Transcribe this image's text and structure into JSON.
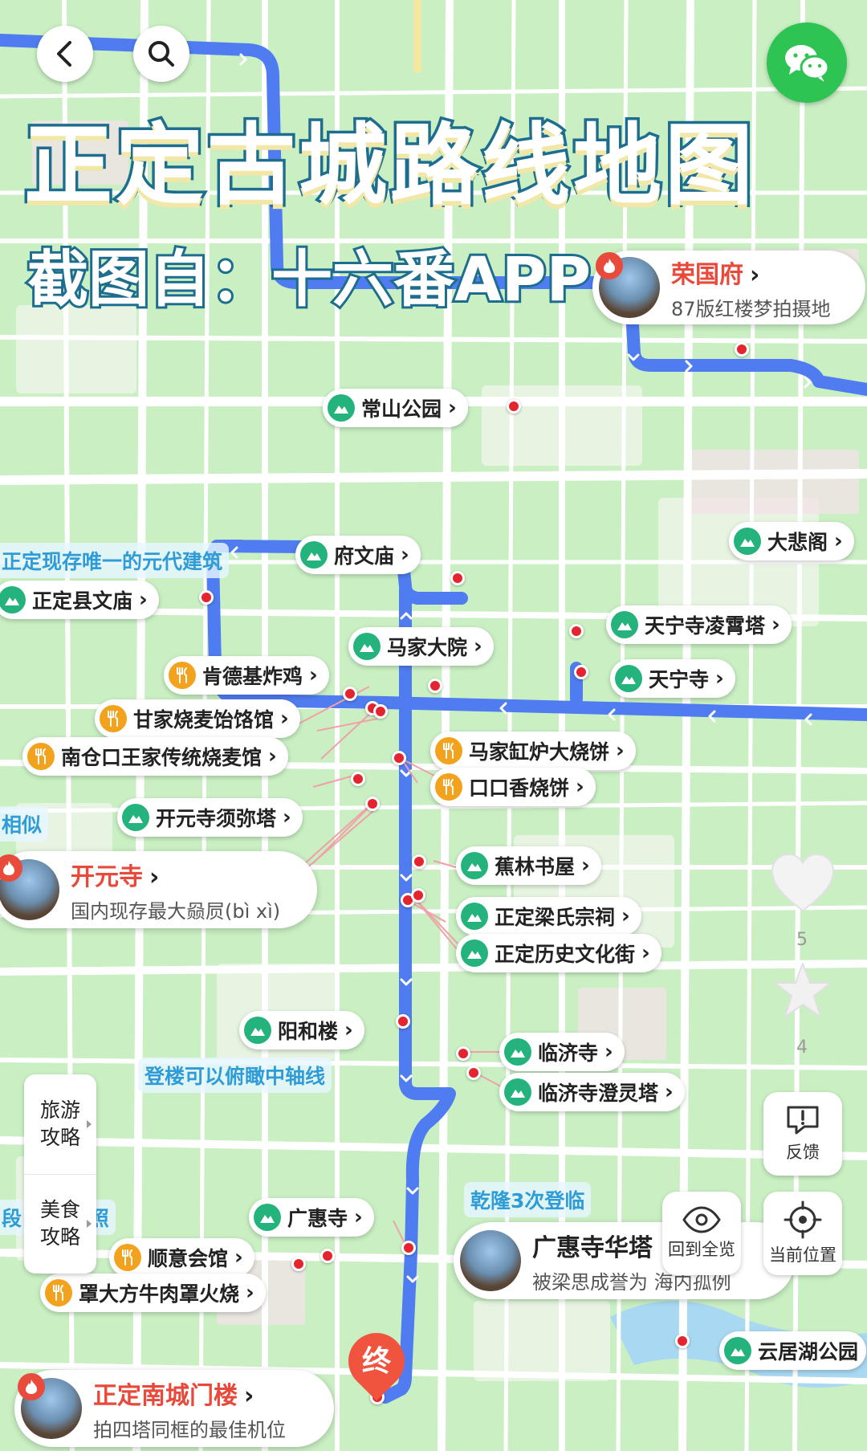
{
  "title": "正定古城路线地图",
  "subtitle": "截图自：十六番APP",
  "colors": {
    "route": "#4f7cf0",
    "map_bg": "#c9efc3",
    "road": "#ffffff",
    "title_stroke": "#1d6d8f",
    "highlight": "#e8493a",
    "scenic_icon": "#24b37c",
    "food_icon": "#f2a21c"
  },
  "controls": {
    "back": "back-icon",
    "search": "search-icon",
    "wechat": "wechat-icon",
    "feedback": "反馈",
    "overview": "回到全览",
    "location": "当前位置",
    "like_count": "5",
    "fav_count": "4"
  },
  "side_menu": {
    "travel": "旅游攻略",
    "food": "美食攻略"
  },
  "featured": {
    "rongguofu": {
      "name": "荣国府",
      "desc": "87版红楼梦拍摄地"
    },
    "kaiyuansi": {
      "name": "开元寺",
      "desc": "国内现存最大赑屃(bì xì)"
    },
    "guanghuisi_ta": {
      "name": "广惠寺华塔",
      "desc": "被梁思成誉为 海内孤例"
    },
    "nanchengmen": {
      "name": "正定南城门楼",
      "desc": "拍四塔同框的最佳机位"
    }
  },
  "scenic": {
    "changshan": "常山公园",
    "dabeige": "大悲阁",
    "fuwenmiao": "府文庙",
    "xianwenmiao": "正定县文庙",
    "lingxiaota": "天宁寺凌霄塔",
    "majiadayuan": "马家大院",
    "tianningsi": "天宁寺",
    "xumita": "开元寺须弥塔",
    "jiaolin": "蕉林书屋",
    "liangshi": "正定梁氏宗祠",
    "lishijie": "正定历史文化街",
    "yanghelou": "阳和楼",
    "linjisi": "临济寺",
    "chenglingta": "临济寺澄灵塔",
    "guanghuisi": "广惠寺",
    "yunjuhu": "云居湖公园"
  },
  "food": {
    "kendeji": "肯德基炸鸡",
    "ganjia": "甘家烧麦饴饹馆",
    "nancangkou": "南仓口王家传统烧麦馆",
    "majiagang": "马家缸炉大烧饼",
    "koukouxiang": "口口香烧饼",
    "shunyi": "顺意会馆",
    "zhaodafang": "罩大方牛肉罩火烧"
  },
  "notes": {
    "yuandai": "正定现存唯一的元代建筑",
    "xiangsi": "相似",
    "denglou": "登楼可以俯瞰中轴线",
    "qianlong": "乾隆3次登临",
    "heshe": "段 适合拍照"
  },
  "end_label": "终"
}
